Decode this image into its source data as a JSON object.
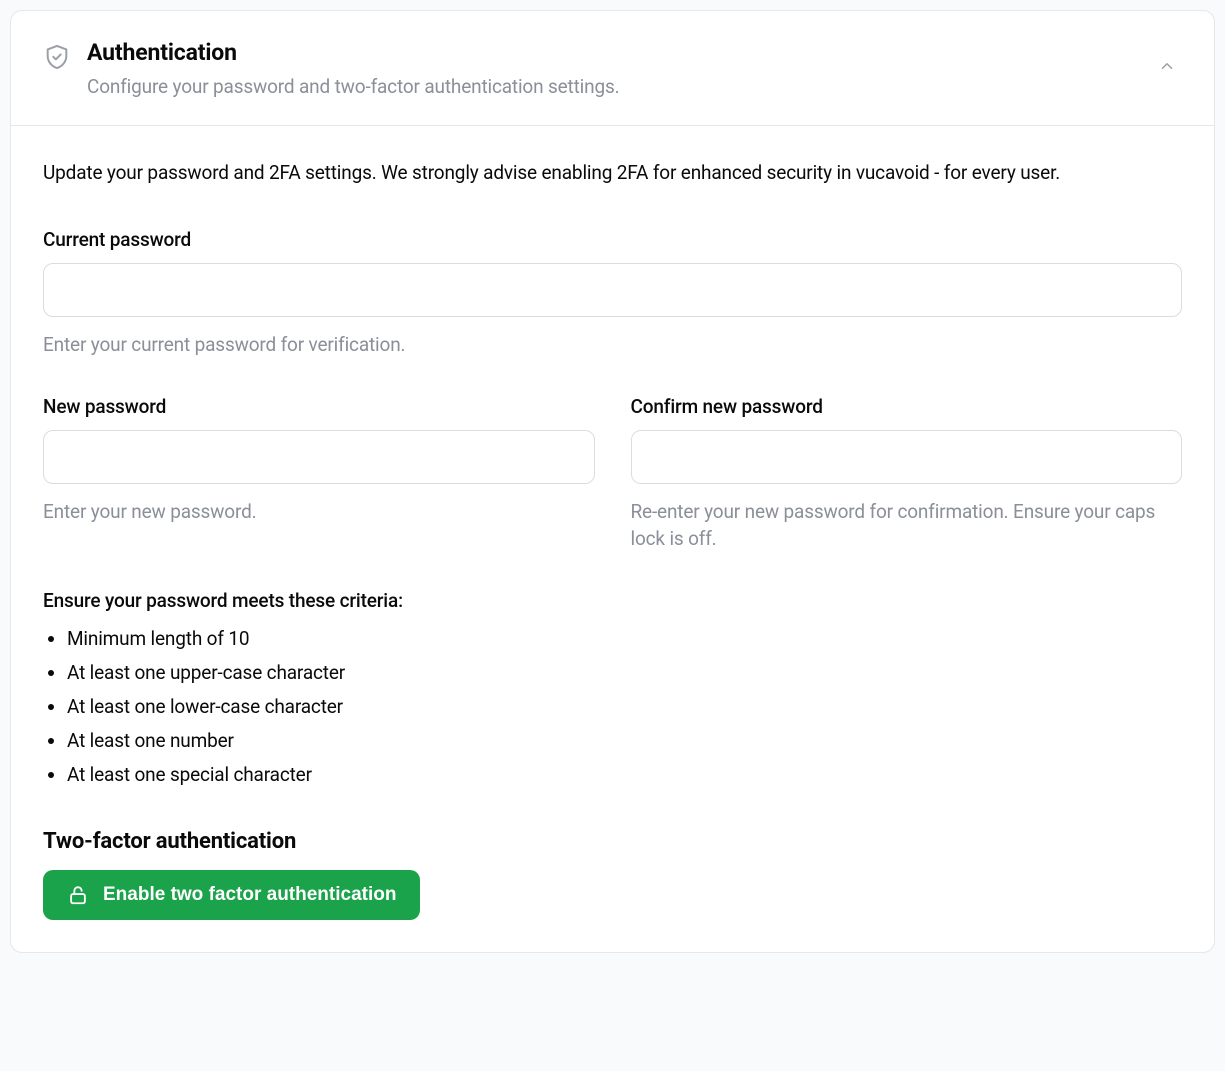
{
  "panel": {
    "title": "Authentication",
    "subtitle": "Configure your password and two-factor authentication settings."
  },
  "intro": "Update your password and 2FA settings. We strongly advise enabling 2FA for enhanced security in vucavoid - for every user.",
  "fields": {
    "current": {
      "label": "Current password",
      "value": "",
      "help": "Enter your current password for verification."
    },
    "new": {
      "label": "New password",
      "value": "",
      "help": "Enter your new password."
    },
    "confirm": {
      "label": "Confirm new password",
      "value": "",
      "help": "Re-enter your new password for confirmation. Ensure your caps lock is off."
    }
  },
  "criteria": {
    "title": "Ensure your password meets these criteria:",
    "items": [
      "Minimum length of 10",
      "At least one upper-case character",
      "At least one lower-case character",
      "At least one number",
      "At least one special character"
    ]
  },
  "two_factor": {
    "heading": "Two-factor authentication",
    "button": "Enable two factor authentication"
  },
  "colors": {
    "accent_green": "#1aa34a",
    "text_muted": "#8a8f98",
    "border": "#e5e7eb"
  }
}
